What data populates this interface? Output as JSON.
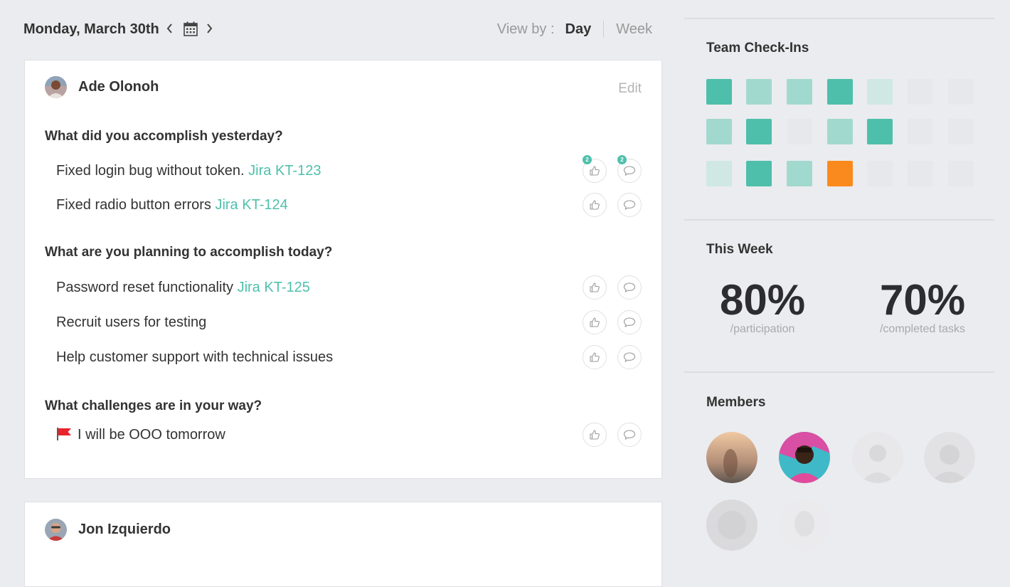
{
  "header": {
    "date": "Monday, March 30th",
    "view_by_label": "View by :",
    "view_day": "Day",
    "view_week": "Week"
  },
  "checkin": {
    "person": "Ade Olonoh",
    "edit_label": "Edit",
    "q1": "What did you accomplish yesterday?",
    "q2": "What are you planning to accomplish today?",
    "q3": "What challenges are in your way?",
    "items": [
      {
        "text": "Fixed login bug without token.",
        "link": "Jira KT-123",
        "likes": "2",
        "comments": "2"
      },
      {
        "text": "Fixed radio button errors",
        "link": "Jira KT-124"
      },
      {
        "text": "Password reset functionality",
        "link": "Jira KT-125"
      },
      {
        "text": "Recruit users for testing",
        "link": ""
      },
      {
        "text": "Help customer support with technical issues",
        "link": ""
      },
      {
        "text": "I will be OOO tomorrow",
        "link": ""
      }
    ]
  },
  "checkin2": {
    "person": "Jon Izquierdo"
  },
  "sidebar": {
    "team_checkins_title": "Team Check-Ins",
    "this_week_title": "This Week",
    "participation_value": "80%",
    "participation_label": "/participation",
    "completed_value": "70%",
    "completed_label": "/completed tasks",
    "members_title": "Members"
  },
  "colors": {
    "accent": "#4fc0ac",
    "grid_strong": "#4dbfab",
    "grid_medium": "#a2d9cf",
    "grid_light": "#cfe8e3",
    "grid_empty": "#e6e8eb",
    "grid_alert": "#fb8a1e",
    "flag": "#e8232c"
  },
  "checkin_grid": [
    [
      "strong",
      "medium",
      "medium",
      "strong",
      "light",
      "empty",
      "empty"
    ],
    [
      "medium",
      "strong",
      "empty",
      "medium",
      "strong",
      "empty",
      "empty"
    ],
    [
      "light",
      "strong",
      "medium",
      "alert",
      "empty",
      "empty",
      "empty"
    ]
  ]
}
